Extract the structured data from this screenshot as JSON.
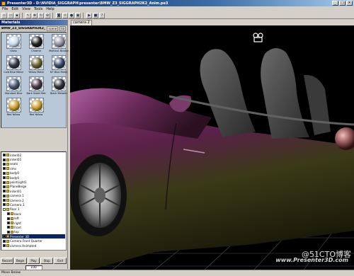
{
  "window": {
    "title": "Presenter3D - D:\\NVIDIA_SIGGRAPH\\presenter\\BMW_Z3_SIGGRAPH2K2_Anim.pe3"
  },
  "menu": [
    "File",
    "Edit",
    "View",
    "Tools",
    "Help"
  ],
  "materials_panel": {
    "title": "Materials",
    "library_name": "BMW_Z3_SIGGRAPH2K2_A",
    "tabs": [
      "scene",
      "lib"
    ],
    "items": [
      {
        "label": "Glass",
        "color": "#c8dcf0"
      },
      {
        "label": "Chrome",
        "color": "#202020"
      },
      {
        "label": "Multicol. Bicolor",
        "color": "#9090a0"
      },
      {
        "label": "Cold Blue Metal",
        "color": "#303848"
      },
      {
        "label": "Yellow Metal",
        "color": "#6a6430"
      },
      {
        "label": "NT Blue Metal",
        "color": "#384868"
      },
      {
        "label": "Standard Blue",
        "color": "#4a5870"
      },
      {
        "label": "Dark Violet Met",
        "color": "#4a3848"
      },
      {
        "label": "Black Metallic",
        "color": "#303038"
      },
      {
        "label": "Red Yellow",
        "color": "#c8a030"
      },
      {
        "label": "Red Yellow",
        "color": "#c8a030"
      }
    ]
  },
  "tree": [
    {
      "label": "interi02",
      "indent": 0,
      "checked": true,
      "selected": false
    },
    {
      "label": "interi01",
      "indent": 0,
      "checked": true,
      "selected": false
    },
    {
      "label": "seats",
      "indent": 0,
      "checked": true,
      "selected": false
    },
    {
      "label": "rims",
      "indent": 0,
      "checked": true,
      "selected": false
    },
    {
      "label": "body0",
      "indent": 0,
      "checked": true,
      "selected": false
    },
    {
      "label": "body0",
      "indent": 0,
      "checked": true,
      "selected": false
    },
    {
      "label": "pointLight1",
      "indent": 0,
      "checked": true,
      "selected": false
    },
    {
      "label": "PlaneBeige",
      "indent": 0,
      "checked": true,
      "selected": false
    },
    {
      "label": "interi01",
      "indent": 0,
      "checked": true,
      "selected": false
    },
    {
      "label": "camera 1",
      "indent": 0,
      "checked": true,
      "selected": false
    },
    {
      "label": "camera 2",
      "indent": 0,
      "checked": true,
      "selected": false
    },
    {
      "label": "Camera 3",
      "indent": 0,
      "checked": true,
      "selected": false
    },
    {
      "label": "floor 1",
      "indent": 0,
      "checked": false,
      "selected": false
    },
    {
      "label": "back",
      "indent": 1,
      "checked": true,
      "selected": false
    },
    {
      "label": "left",
      "indent": 1,
      "checked": true,
      "selected": false
    },
    {
      "label": "right",
      "indent": 1,
      "checked": true,
      "selected": false
    },
    {
      "label": "front",
      "indent": 1,
      "checked": true,
      "selected": false
    },
    {
      "label": "top",
      "indent": 1,
      "checked": true,
      "selected": false
    },
    {
      "label": "Presenter 3D",
      "indent": 0,
      "checked": true,
      "selected": true
    },
    {
      "label": "Camera Front Quarter",
      "indent": 0,
      "checked": true,
      "selected": false
    },
    {
      "label": "camera Animated",
      "indent": 0,
      "checked": true,
      "selected": false
    }
  ],
  "anim": {
    "buttons": [
      "Record",
      "Begin",
      "Play",
      "Stop",
      "End"
    ],
    "frame": "100"
  },
  "viewport": {
    "tab": "camera 2",
    "watermark": "www.Presenter3D.com",
    "blog": "@51CTO博客"
  },
  "statusbar": {
    "text": "Move Below"
  }
}
